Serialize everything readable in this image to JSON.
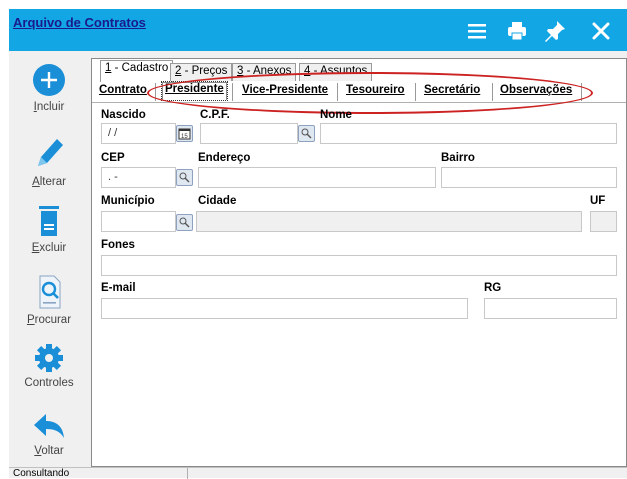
{
  "window": {
    "title": "Arquivo de Contratos"
  },
  "toolbar": {
    "icons": [
      "menu-icon",
      "print-icon",
      "pin-icon",
      "close-icon"
    ]
  },
  "sidebar": {
    "items": [
      {
        "prefix": "I",
        "rest": "ncluir",
        "icon": "add-circle-icon"
      },
      {
        "prefix": "A",
        "rest": "lterar",
        "icon": "pencil-icon"
      },
      {
        "prefix": "E",
        "rest": "xcluir",
        "icon": "trash-icon"
      },
      {
        "prefix": "P",
        "rest": "rocurar",
        "icon": "search-document-icon"
      },
      {
        "prefix": "",
        "rest": "Controles",
        "icon": "gear-icon"
      },
      {
        "prefix": "V",
        "rest": "oltar",
        "icon": "back-arrow-icon"
      }
    ]
  },
  "tabs_main": [
    {
      "num": "1",
      "rest": " - Cadastro",
      "active": true
    },
    {
      "num": "2",
      "rest": " - Preços",
      "active": false
    },
    {
      "num": "3",
      "rest": " - Anexos",
      "active": false
    },
    {
      "num": "4",
      "rest": " - Assuntos",
      "active": false
    }
  ],
  "tabs_sub": [
    {
      "label": "Contrato",
      "active": false
    },
    {
      "label": "Presidente",
      "active": true
    },
    {
      "label": "Vice-Presidente",
      "active": false
    },
    {
      "label": "Tesoureiro",
      "active": false
    },
    {
      "label": "Secretário",
      "active": false
    },
    {
      "label": "Observações",
      "active": false
    }
  ],
  "form": {
    "nascido_label": "Nascido",
    "nascido_value": "/ /",
    "cpf_label": "C.P.F.",
    "cpf_value": "",
    "nome_label": "Nome",
    "nome_value": "",
    "cep_label": "CEP",
    "cep_value": ".  -",
    "endereco_label": "Endereço",
    "endereco_value": "",
    "bairro_label": "Bairro",
    "bairro_value": "",
    "municipio_label": "Município",
    "municipio_value": "",
    "cidade_label": "Cidade",
    "cidade_value": "",
    "uf_label": "UF",
    "uf_value": "",
    "fones_label": "Fones",
    "fones_value": "",
    "email_label": "E-mail",
    "email_value": "",
    "rg_label": "RG",
    "rg_value": ""
  },
  "status": {
    "text": "Consultando"
  },
  "colors": {
    "titlebar": "#12a6e4",
    "icon_blue": "#1a8fd8",
    "highlight": "#cc2222"
  }
}
